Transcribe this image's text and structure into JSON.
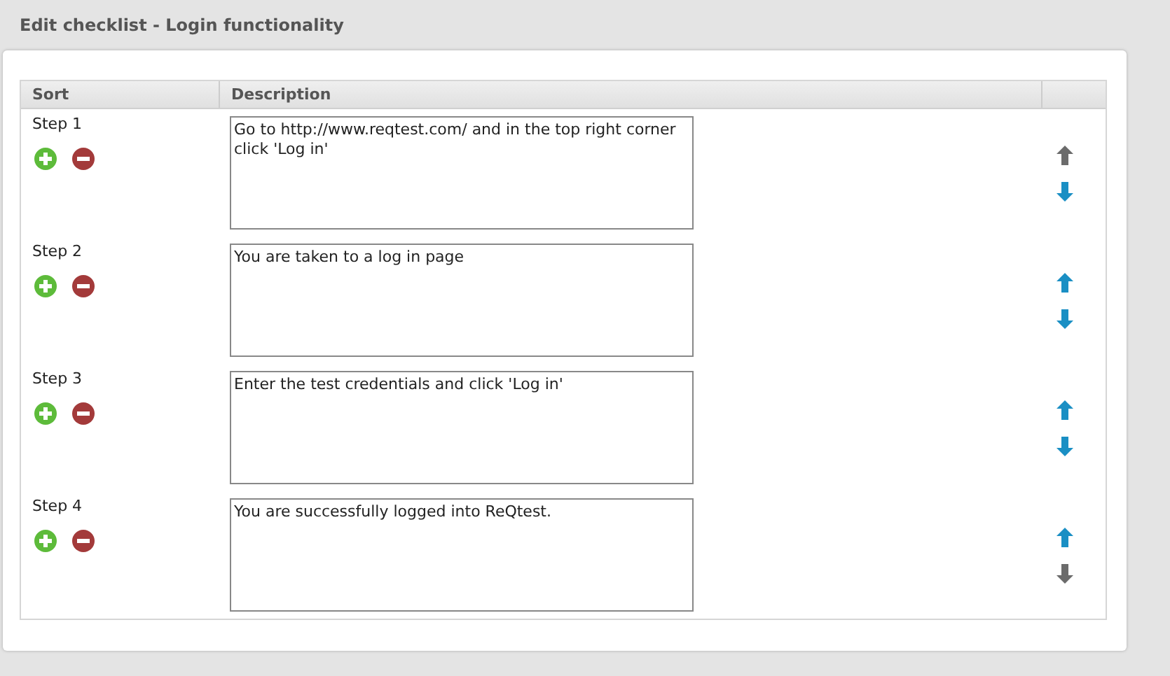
{
  "title": "Edit checklist - Login functionality",
  "table": {
    "columns": [
      "Sort",
      "Description"
    ],
    "rows": [
      {
        "step": "Step 1",
        "description": "Go to http://www.reqtest.com/ and in the top right corner click 'Log in'",
        "up_disabled": true,
        "down_disabled": false
      },
      {
        "step": "Step 2",
        "description": "You are taken to a log in page",
        "up_disabled": false,
        "down_disabled": false
      },
      {
        "step": "Step 3",
        "description": "Enter the test credentials and click 'Log in'",
        "up_disabled": false,
        "down_disabled": false
      },
      {
        "step": "Step 4",
        "description": "You are successfully logged into ReQtest.",
        "up_disabled": false,
        "down_disabled": true
      }
    ]
  }
}
